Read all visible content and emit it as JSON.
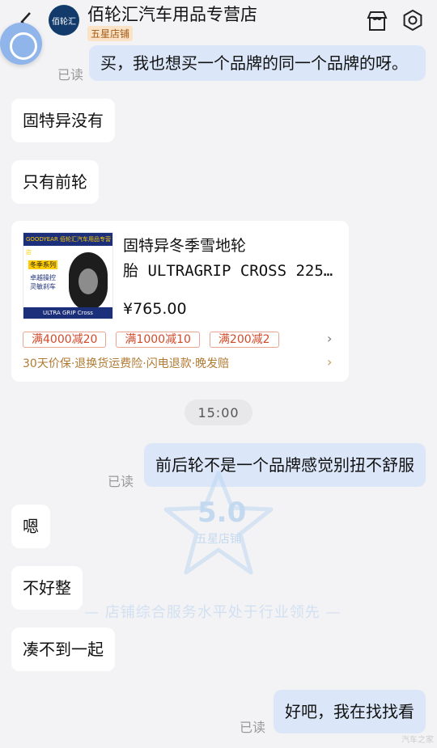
{
  "header": {
    "shop_name": "佰轮汇汽车用品专营店",
    "shop_badge": "五星店铺",
    "logo_text": "佰轮汇"
  },
  "messages": {
    "m1": "买，我也想买一个品牌的同一个品牌的呀。",
    "m2": "固特异没有",
    "m3": "只有前轮",
    "m4": "前后轮不是一个品牌感觉别扭不舒服",
    "m5": "嗯",
    "m6": "不好整",
    "m7": "凑不到一起",
    "m8": "好吧，我在找找看"
  },
  "read_label": "已读",
  "time_divider": "15:00",
  "product": {
    "title_line1": "固特异冬季雪地轮",
    "title_line2": "胎 ULTRAGRIP CROSS 225...",
    "price": "¥765.00",
    "coupons": [
      "满4000减20",
      "满1000减10",
      "满200减2"
    ],
    "services": "30天价保·退换货运费险·闪电退款·晚发赔",
    "img_brand": "GOODYEAR",
    "img_top_text": "佰轮汇汽车用品专营店",
    "img_tag": "冬季系列",
    "img_sub": "卓越操控 灵敏刹车",
    "img_bottom": "ULTRA GRIP Cross"
  },
  "watermark": {
    "score": "5.0",
    "label": "五星店铺",
    "line": "— 店铺综合服务水平处于行业领先 —"
  },
  "corner_mark": "汽车之家",
  "colors": {
    "background": "#f3f3f5",
    "own_bubble": "#dbe7f9",
    "other_bubble": "#ffffff",
    "coupon": "#d14a2a",
    "services": "#b07a33"
  }
}
